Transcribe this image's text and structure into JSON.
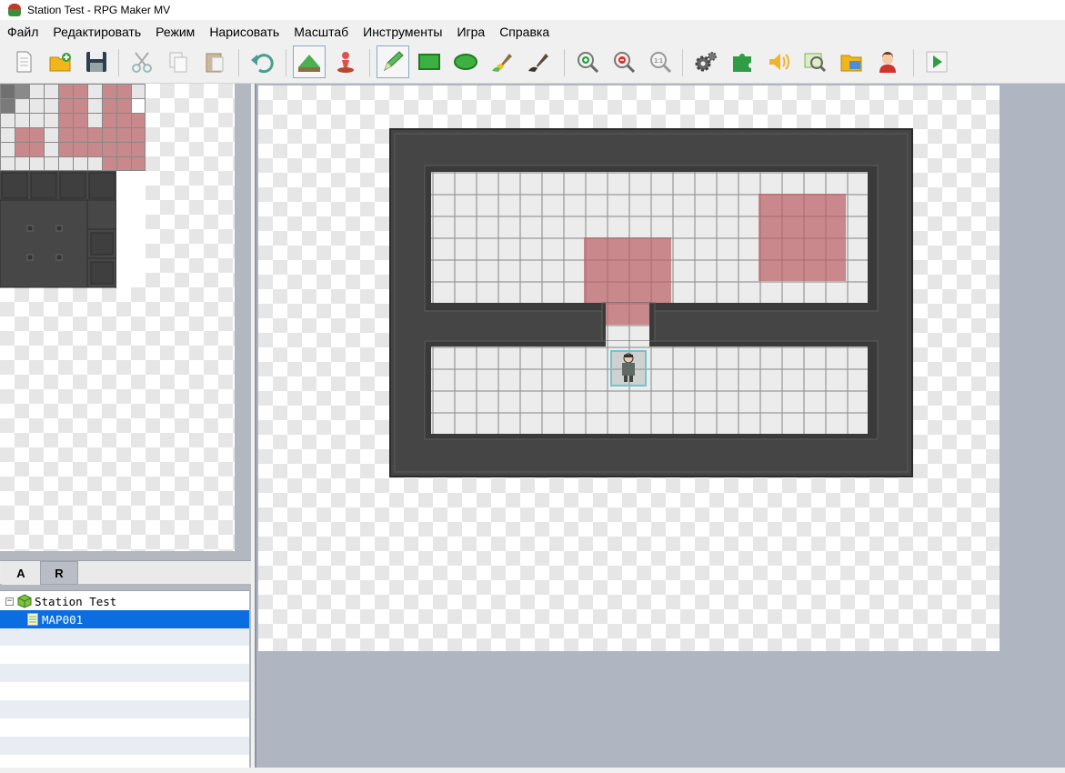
{
  "window": {
    "title": "Station Test - RPG Maker MV"
  },
  "menu": [
    "Файл",
    "Редактировать",
    "Режим",
    "Нарисовать",
    "Масштаб",
    "Инструменты",
    "Игра",
    "Справка"
  ],
  "toolbar": {
    "icons": [
      "new-project-icon",
      "open-project-icon",
      "save-icon",
      "cut-icon",
      "copy-icon",
      "paste-icon",
      "undo-icon",
      "map-mode-icon",
      "event-mode-icon",
      "pencil-icon",
      "rectangle-icon",
      "ellipse-icon",
      "fill-icon",
      "shadow-pen-icon",
      "zoom-in-icon",
      "zoom-out-icon",
      "zoom-actual-icon",
      "database-icon",
      "plugin-manager-icon",
      "sound-test-icon",
      "event-searcher-icon",
      "resource-manager-icon",
      "character-generator-icon",
      "playtest-icon"
    ],
    "zoom_actual_label": "1:1",
    "active": [
      "map-mode-icon",
      "pencil-icon"
    ]
  },
  "tileset_tabs": [
    "A",
    "R"
  ],
  "active_tab": "R",
  "map_tree": {
    "project": "Station Test",
    "maps": [
      {
        "name": "MAP001",
        "selected": true
      }
    ]
  },
  "colors": {
    "floor": "#e6e6e6",
    "wall": "#444444",
    "pink": "#c9888b",
    "selection": "#0a6ee0"
  }
}
